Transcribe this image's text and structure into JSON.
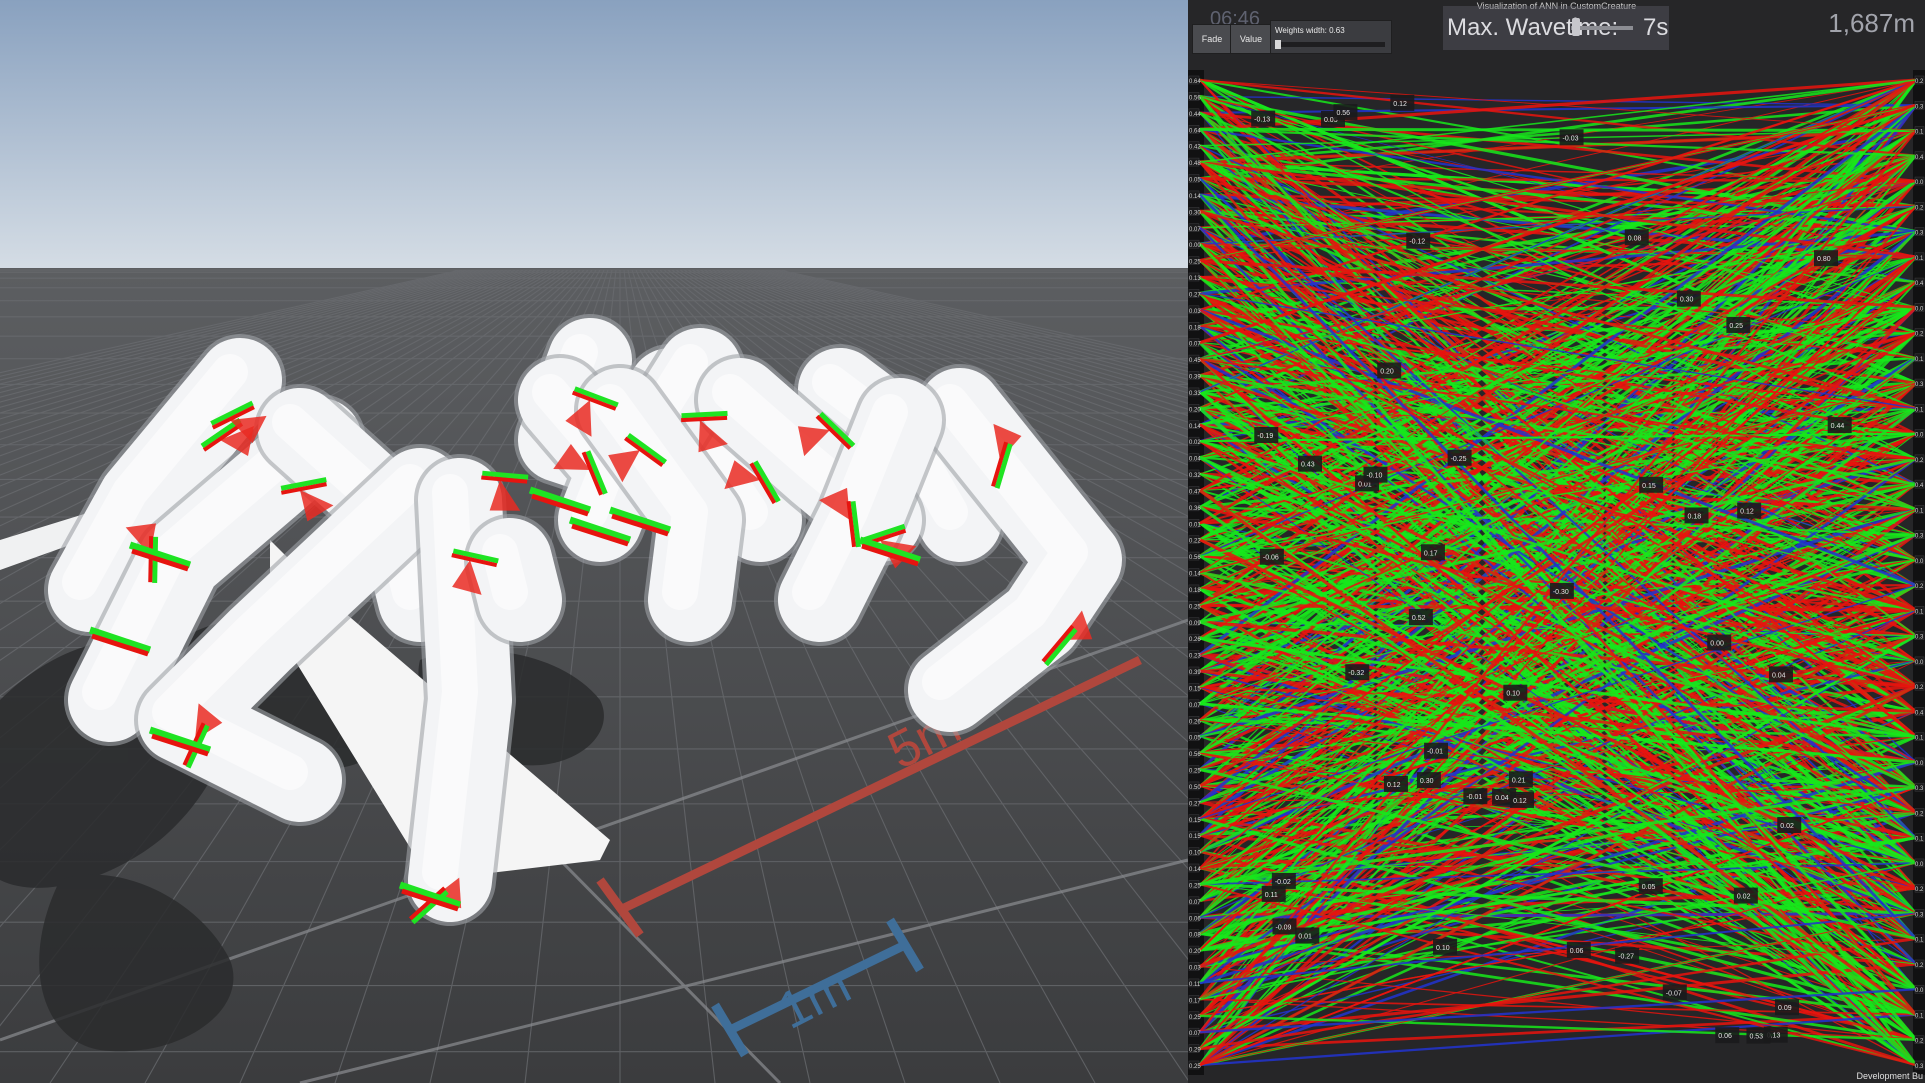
{
  "panel": {
    "title": "Visualization of ANN in CustomCreature",
    "time": "06:46",
    "fade_label": "Fade",
    "value_label": "Value",
    "weights_width_label": "Weights width: 0.63",
    "wave_label": "Max. Wavetime:",
    "wave_value": "7s",
    "wave_slider_fraction": 0.05,
    "weights_slider_fraction": 0.0,
    "distance": "1,687m",
    "footer": "Development Bu"
  },
  "scene": {
    "marker_5m": "5m",
    "marker_1m": "1m"
  },
  "ann": {
    "left_scale": [
      "0.64",
      "0.56",
      "0.44",
      "0.64",
      "0.42",
      "0.48",
      "0.05",
      "0.14",
      "0.30",
      "0.07",
      "0.00",
      "0.25",
      "0.13",
      "0.27",
      "0.03",
      "0.18",
      "0.07",
      "0.45",
      "0.39",
      "0.33",
      "0.20",
      "0.14",
      "0.02",
      "0.04",
      "0.32",
      "0.47",
      "0.36",
      "0.01",
      "0.22",
      "0.56",
      "0.14",
      "0.18",
      "0.25",
      "0.09",
      "0.26",
      "0.23",
      "0.39",
      "0.15",
      "0.07",
      "0.26",
      "0.05",
      "0.56",
      "0.25",
      "0.50",
      "0.27",
      "0.15",
      "0.15",
      "0.10",
      "0.14",
      "0.25",
      "0.07",
      "0.06",
      "0.08",
      "0.20",
      "0.03",
      "0.11",
      "0.17",
      "0.25",
      "0.07",
      "0.29",
      "0.25"
    ],
    "right_scale": [
      "0.2",
      "0.3",
      "0.1",
      "0.4",
      "0.0",
      "0.2",
      "0.3",
      "0.1",
      "0.4",
      "0.0",
      "0.2",
      "0.1",
      "0.3",
      "0.1",
      "0.0",
      "0.2",
      "0.4",
      "0.1",
      "0.3",
      "0.0",
      "0.2",
      "0.1",
      "0.3",
      "0.0",
      "0.2",
      "0.4",
      "0.1",
      "0.0",
      "0.3",
      "0.2",
      "0.1",
      "0.0",
      "0.2",
      "0.3",
      "0.1",
      "0.2",
      "0.0",
      "0.1",
      "0.2",
      "0.3"
    ],
    "weight_labels": [
      "0.10",
      "0.01",
      "0.05",
      "0.00",
      "0.13",
      "-0.12",
      "0.04",
      "0.52",
      "0.30",
      "0.18",
      "0.12",
      "-0.03",
      "-0.13",
      "0.06",
      "0.17",
      "0.05",
      "-0.30",
      "0.44",
      "0.80",
      "-0.25",
      "0.53",
      "-0.10",
      "-0.27",
      "0.12",
      "0.02",
      "0.15",
      "0.06",
      "-0.02",
      "0.25",
      "0.11",
      "-0.01",
      "-0.01",
      "0.01",
      "0.02",
      "0.30",
      "-0.19",
      "0.43",
      "0.56",
      "-0.32",
      "0.10",
      "-0.06",
      "0.09",
      "0.04",
      "-0.07",
      "0.12",
      "-0.09",
      "0.21",
      "0.20",
      "0.12",
      "0.08"
    ]
  },
  "colors": {
    "weight_positive": "#17e81b",
    "weight_negative": "#e8140e",
    "weight_neutral": "#2233d0",
    "sky_top": "#89a1bf",
    "sky_bottom": "#d5dde5",
    "ground": "#4b4d50",
    "limb": "#f2f3f5",
    "marker_red": "#b0473d",
    "marker_blue": "#3f6e99"
  }
}
